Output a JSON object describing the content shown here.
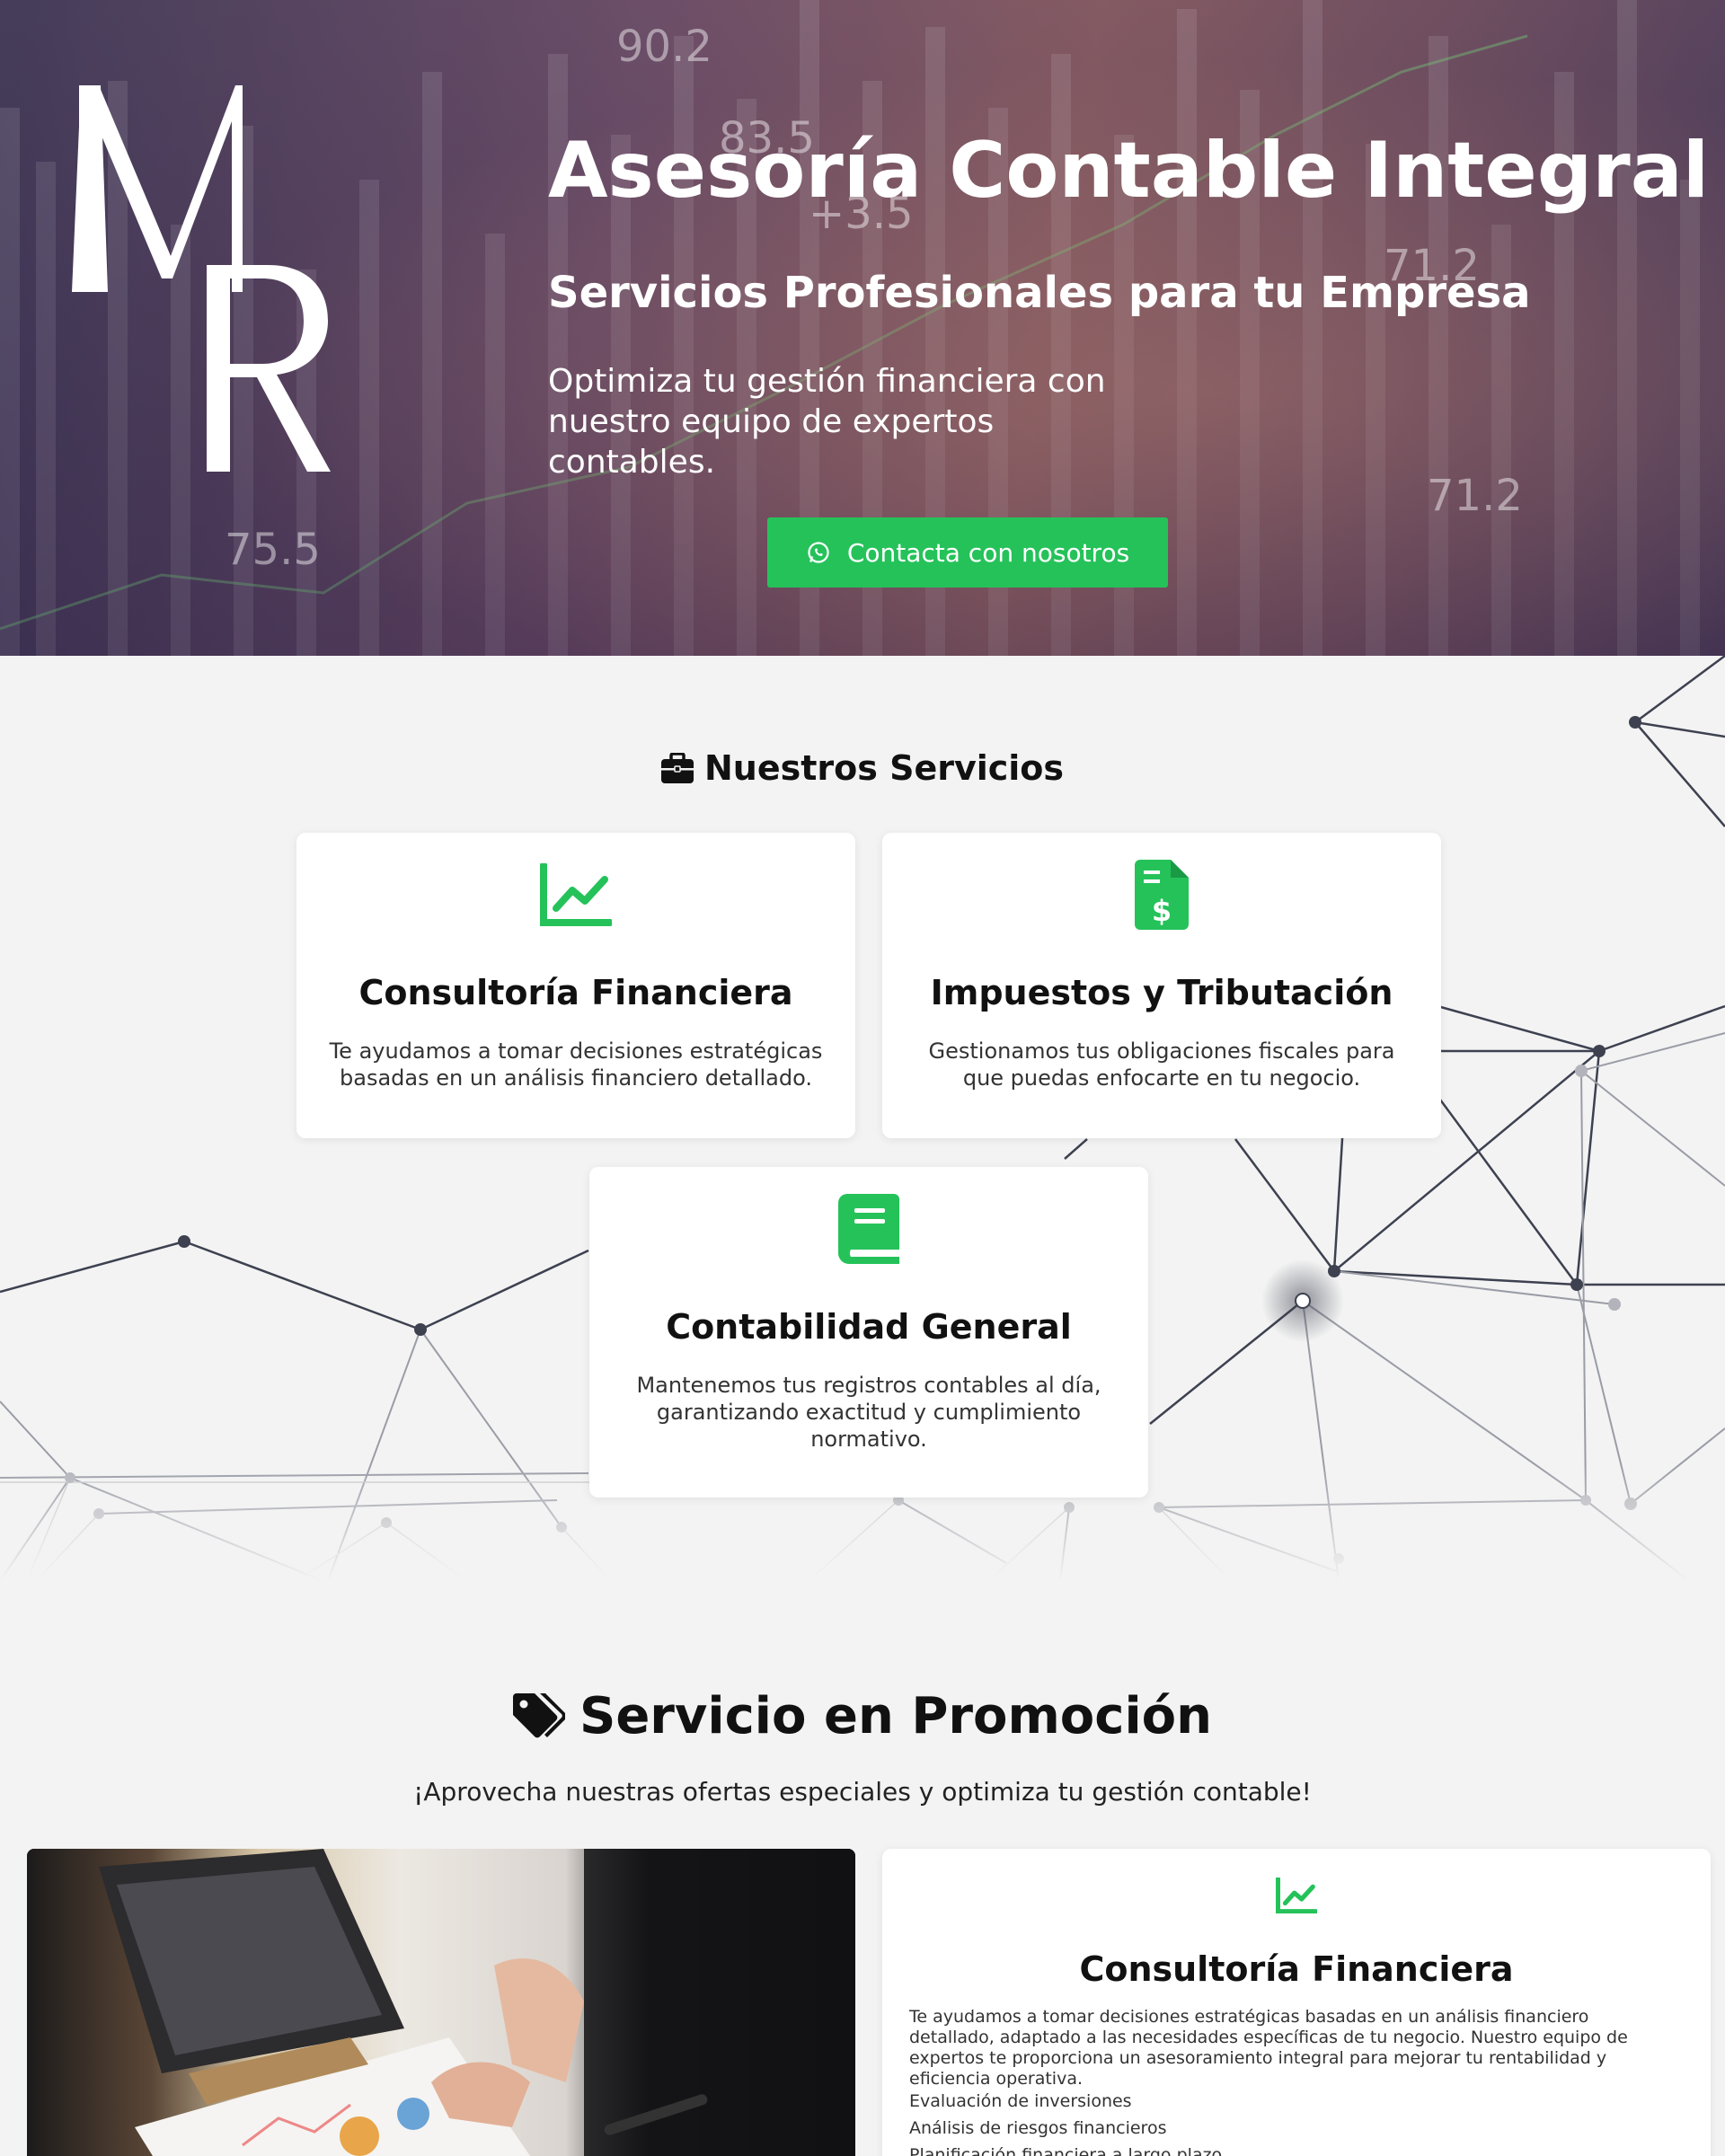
{
  "hero": {
    "title": "Asesoría Contable Integral",
    "subtitle": "Servicios Profesionales para tu Empresa",
    "description": "Optimiza tu gestión financiera con nuestro equipo de expertos contables.",
    "cta_label": "Contacta con nosotros",
    "logo_text": "MR",
    "background_numbers": [
      "90.2",
      "83.5",
      "+3.5",
      "71.2",
      "75.5",
      "71.2"
    ]
  },
  "services": {
    "title": "Nuestros Servicios",
    "items": [
      {
        "title": "Consultoría Financiera",
        "description": "Te ayudamos a tomar decisiones estratégicas basadas en un análisis financiero detallado.",
        "icon": "chart-line-icon"
      },
      {
        "title": "Impuestos y Tributación",
        "description": "Gestionamos tus obligaciones fiscales para que puedas enfocarte en tu negocio.",
        "icon": "invoice-dollar-icon"
      },
      {
        "title": "Contabilidad General",
        "description": "Mantenemos tus registros contables al día, garantizando exactitud y cumplimiento normativo.",
        "icon": "book-icon"
      }
    ]
  },
  "promo": {
    "title": "Servicio en Promoción",
    "subtitle": "¡Aprovecha nuestras ofertas especiales y optimiza tu gestión contable!",
    "card": {
      "title": "Consultoría Financiera",
      "description": "Te ayudamos a tomar decisiones estratégicas basadas en un análisis financiero detallado, adaptado a las necesidades específicas de tu negocio. Nuestro equipo de expertos te proporciona un asesoramiento integral para mejorar tu rentabilidad y eficiencia operativa.",
      "features": [
        "Evaluación de inversiones",
        "Análisis de riesgos financieros",
        "Planificación financiera a largo plazo"
      ]
    }
  },
  "colors": {
    "accent": "#25c25a",
    "text": "#111111",
    "background": "#f3f3f3"
  }
}
